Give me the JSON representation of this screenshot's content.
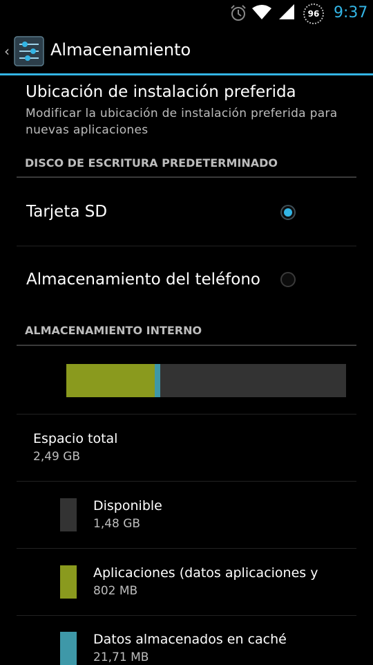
{
  "status_bar": {
    "icons": [
      "alarm-icon",
      "wifi-icon",
      "signal-icon"
    ],
    "battery_level": "96",
    "time": "9:37"
  },
  "action_bar": {
    "title": "Almacenamiento",
    "accent_color": "#33b5e5"
  },
  "install_location": {
    "title": "Ubicación de instalación preferida",
    "summary": "Modificar la ubicación de instalación preferida para nuevas aplicaciones"
  },
  "default_write_disk": {
    "header": "DISCO DE ESCRITURA PREDETERMINADO",
    "options": [
      {
        "label": "Tarjeta SD",
        "checked": true
      },
      {
        "label": "Almacenamiento del teléfono",
        "checked": false
      }
    ]
  },
  "internal_storage": {
    "header": "ALMACENAMIENTO INTERNO",
    "usage": [
      {
        "name": "Aplicaciones",
        "fraction": 0.315,
        "color": "#8a9a1e"
      },
      {
        "name": "Datos almacenados en caché",
        "fraction": 0.02,
        "color": "#3e98a8"
      },
      {
        "name": "Disponible",
        "fraction": 0.665,
        "color": "#333333"
      }
    ],
    "total": {
      "label": "Espacio total",
      "value": "2,49 GB"
    },
    "items": [
      {
        "label": "Disponible",
        "value": "1,48 GB",
        "color": "#333333"
      },
      {
        "label": "Aplicaciones (datos aplicaciones y",
        "value": "802 MB",
        "color": "#8a9a1e"
      },
      {
        "label": "Datos almacenados en caché",
        "value": "21,71 MB",
        "color": "#3e98a8"
      }
    ]
  }
}
